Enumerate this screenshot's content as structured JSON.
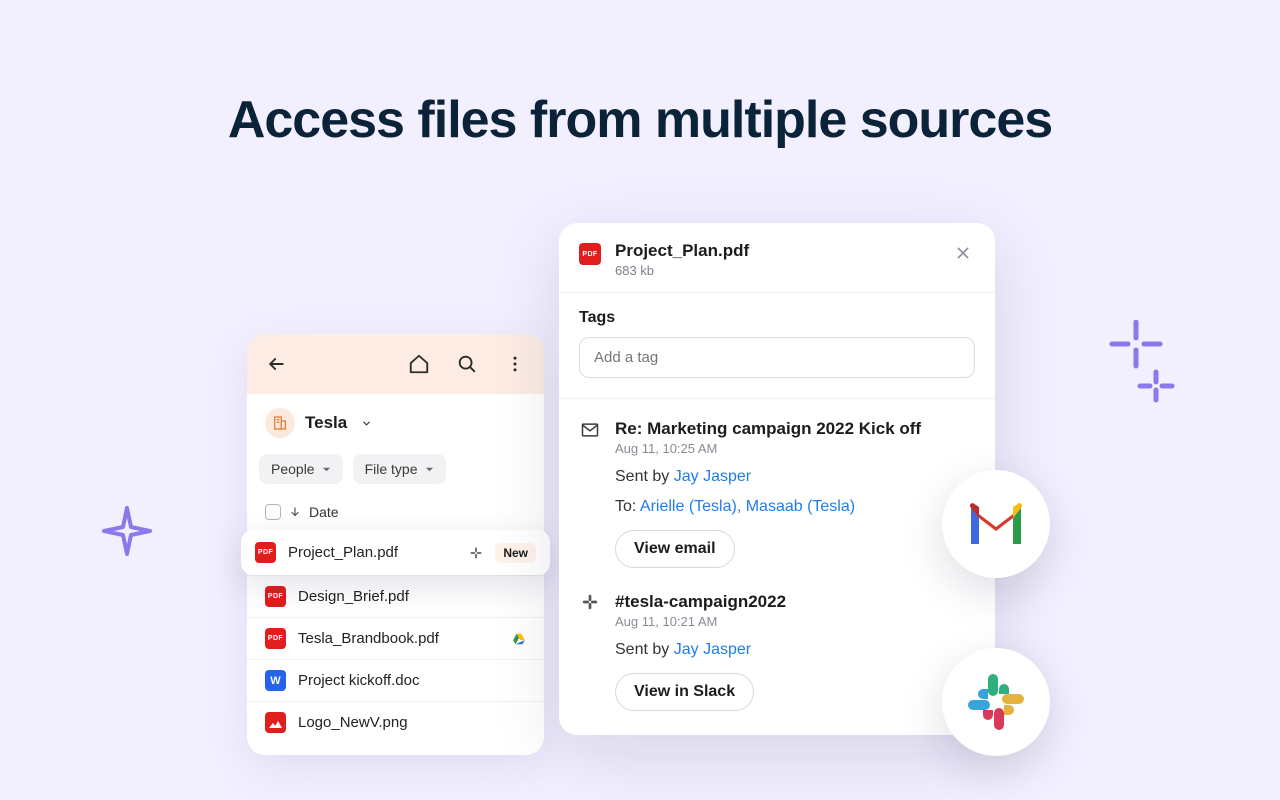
{
  "headline": "Access files from multiple sources",
  "file_panel": {
    "workspace": "Tesla",
    "filters": {
      "people": "People",
      "filetype": "File type"
    },
    "date_col": "Date",
    "files": [
      {
        "name": "Project_Plan.pdf",
        "type": "pdf",
        "highlight": true,
        "via": "slack",
        "badge": "New"
      },
      {
        "name": "Design_Brief.pdf",
        "type": "pdf"
      },
      {
        "name": "Tesla_Brandbook.pdf",
        "type": "pdf",
        "via": "gdrive"
      },
      {
        "name": "Project kickoff.doc",
        "type": "doc"
      },
      {
        "name": "Logo_NewV.png",
        "type": "img"
      }
    ]
  },
  "detail": {
    "title": "Project_Plan.pdf",
    "size": "683 kb",
    "tags_label": "Tags",
    "tag_placeholder": "Add a tag",
    "sources": [
      {
        "kind": "email",
        "title": "Re: Marketing campaign 2022 Kick off",
        "time": "Aug 11, 10:25 AM",
        "sent_by_label": "Sent by",
        "sent_by": "Jay Jasper",
        "to_label": "To:",
        "to": "Arielle (Tesla), Masaab (Tesla)",
        "button": "View email"
      },
      {
        "kind": "slack",
        "title": "#tesla-campaign2022",
        "time": "Aug 11, 10:21 AM",
        "sent_by_label": "Sent by",
        "sent_by": "Jay Jasper",
        "button": "View in Slack"
      }
    ]
  }
}
